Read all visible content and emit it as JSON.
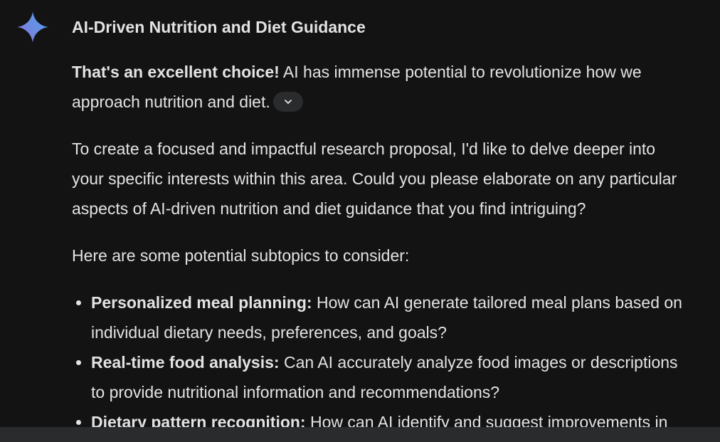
{
  "title": "AI-Driven Nutrition and Diet Guidance",
  "icon": "gemini-spark-icon",
  "intro": {
    "bold": "That's an excellent choice!",
    "line1_rest": " AI has immense potential to revolutionize how we",
    "line2": "approach nutrition and diet."
  },
  "expand_icon": "chevron-down-icon",
  "para2": {
    "line1": "To create a focused and impactful research proposal, I'd like to delve deeper into",
    "line2": "your specific interests within this area. Could you please elaborate on any particular",
    "line3": "aspects of AI-driven nutrition and diet guidance that you find intriguing?"
  },
  "para3": "Here are some potential subtopics to consider:",
  "subtopics": [
    {
      "bold": "Personalized meal planning:",
      "line1_rest": " How can AI generate tailored meal plans based on",
      "line2": "individual dietary needs, preferences, and goals?"
    },
    {
      "bold": "Real-time food analysis:",
      "line1_rest": " Can AI accurately analyze food images or descriptions",
      "line2": "to provide nutritional information and recommendations?"
    },
    {
      "bold": "Dietary pattern recognition:",
      "line1_rest": " How can AI identify and suggest improvements in",
      "line2": ""
    }
  ],
  "colors": {
    "background": "#131314",
    "text": "#e3e3e3",
    "chip": "#2a2b2d",
    "bottom_bar": "#2a2b2c"
  }
}
